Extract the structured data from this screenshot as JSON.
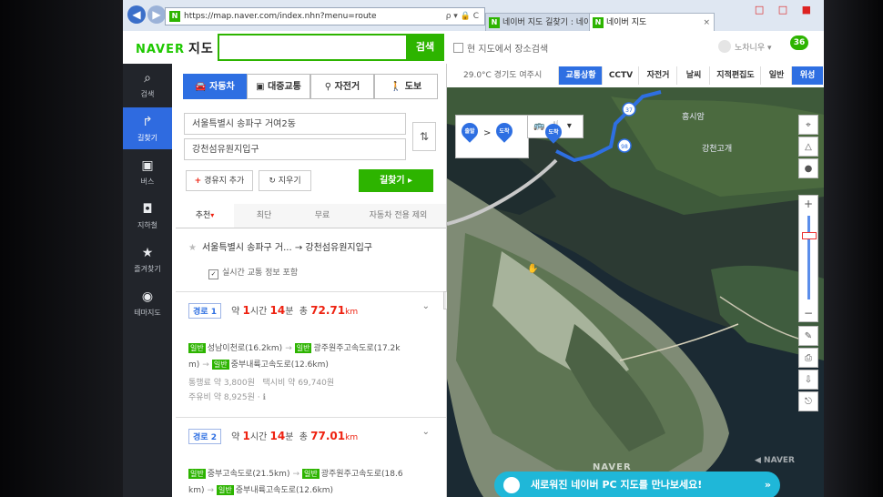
{
  "browser": {
    "url": "https://map.naver.com/index.nhn?menu=route",
    "address_controls": "ρ ▾ 🔒 C",
    "tabs": [
      {
        "label": "네이버 지도 길찾기 : 네이버"
      },
      {
        "label": "네이버 지도"
      }
    ],
    "tab_close": "×",
    "window_buttons": "□ □ ■",
    "favicon_letter": "N"
  },
  "header": {
    "logo_brand": "NAVER",
    "logo_service": "지도",
    "search_value": "",
    "search_button": "검색",
    "checkbox_label": "현 지도에서 장소검색",
    "user_name": "노차니우 ▾",
    "notification_count": "36"
  },
  "rail": [
    {
      "icon": "search-icon",
      "glyph": "⌕",
      "label": "검색",
      "active": false
    },
    {
      "icon": "route-icon",
      "glyph": "↱",
      "label": "길찾기",
      "active": true
    },
    {
      "icon": "bus-icon",
      "glyph": "▣",
      "label": "버스",
      "active": false
    },
    {
      "icon": "subway-icon",
      "glyph": "◘",
      "label": "지하철",
      "active": false
    },
    {
      "icon": "star-icon",
      "glyph": "★",
      "label": "즐겨찾기",
      "active": false
    },
    {
      "icon": "pin-icon",
      "glyph": "◉",
      "label": "테마지도",
      "active": false
    }
  ],
  "route": {
    "modes": [
      {
        "icon": "car-icon",
        "glyph": "🚘",
        "label": "자동차",
        "active": true
      },
      {
        "icon": "bus-icon",
        "glyph": "▣",
        "label": "대중교통",
        "active": false
      },
      {
        "icon": "bicycle-icon",
        "glyph": "⚲",
        "label": "자전거",
        "active": false
      },
      {
        "icon": "walk-icon",
        "glyph": "🚶",
        "label": "도보",
        "active": false
      }
    ],
    "origin": "서울특별시 송파구 거여2동",
    "destination": "강천섬유원지입구",
    "swap_glyph": "⇅",
    "add_waypoint": "경유지 추가",
    "add_waypoint_glyph": "+",
    "clear": "지우기",
    "clear_glyph": "↻",
    "search_route": "길찾기 ▸",
    "sort_tabs": [
      {
        "label": "추천",
        "active": true
      },
      {
        "label": "최단",
        "active": false
      },
      {
        "label": "무료",
        "active": false
      },
      {
        "label": "자동차 전용 제외",
        "active": false
      }
    ],
    "sort_caret": "▾",
    "summary_glyph": "★",
    "summary": "서울특별시 송파구 거... → 강천섬유원지입구",
    "realtime_checked": true,
    "realtime_label": "실시간 교통 정보 포함",
    "results": [
      {
        "name": "경로 1",
        "prefix": "약",
        "hours": "1",
        "hours_unit": "시간",
        "minutes": "14",
        "minutes_unit": "분",
        "total_label": "총",
        "distance": "72.71",
        "distance_unit": "km",
        "road_tag": "일반",
        "road_tag_2": "일반",
        "road_tag_3": "일반",
        "line1_a": "성남이천로(16.2km)",
        "line1_b": "광주원주고속도로(17.2k",
        "line2_prefix": "m)",
        "line2_b": "중부내륙고속도로(12.6km)",
        "toll": "통행료 약 3,800원",
        "taxi": "택시비 약 69,740원",
        "fuel": "주유비 약 8,925원 · ℹ"
      },
      {
        "name": "경로 2",
        "prefix": "약",
        "hours": "1",
        "hours_unit": "시간",
        "minutes": "14",
        "minutes_unit": "분",
        "total_label": "총",
        "distance": "77.01",
        "distance_unit": "km",
        "road_tag": "일반",
        "road_tag_2": "일반",
        "road_tag_3": "일반",
        "line1_a": "중부고속도로(21.5km)",
        "line1_b": "광주원주고속도로(18.6",
        "line2_prefix": "km)",
        "line2_b": "중부내륙고속도로(12.6km)"
      }
    ],
    "expand_glyph": "⌄",
    "arrow": "→",
    "collapse_glyph": "‹"
  },
  "map": {
    "weather": "29.0°C  경기도 여주시",
    "layer_tabs": [
      {
        "label": "교통상황",
        "active": true
      },
      {
        "label": "CCTV",
        "active": false
      },
      {
        "label": "자전거",
        "active": false
      },
      {
        "label": "날씨",
        "active": false
      },
      {
        "label": "지적편집도",
        "active": false
      },
      {
        "label": "일반",
        "active": false
      },
      {
        "label": "위성",
        "active": true
      }
    ],
    "start_pin": "출발",
    "end_pin": "도착",
    "pin_arrow": ">",
    "destination_pin": "도착",
    "road_badges": [
      "37",
      "98"
    ],
    "place_labels": [
      "흥시암",
      "강천고개"
    ],
    "tools_glyph": "🚌🍴▾",
    "right_controls": [
      "⌖",
      "△",
      "●"
    ],
    "zoom_in": "+",
    "zoom_out": "−",
    "bottom_controls": [
      "✎",
      "⎙",
      "⇩",
      "⎋"
    ],
    "watermark": "NAVER",
    "watermark_2": "◀ NAVER",
    "banner_text": "새로워진 네이버 PC 지도를 만나보세요!",
    "banner_close": "»",
    "cursor_glyph": "✋"
  },
  "colors": {
    "naver_green": "#2db400",
    "accent_blue": "#2e6fe2",
    "highlight_red": "#e21111",
    "banner_cyan": "#1fb7d8"
  }
}
